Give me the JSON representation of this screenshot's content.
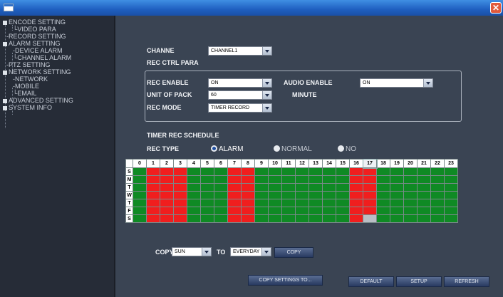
{
  "window": {
    "close_glyph": "✕"
  },
  "sidebar": {
    "items": [
      {
        "label": "ENCODE SETTING"
      },
      {
        "label": "VIDEO PARA"
      },
      {
        "label": "RECORD SETTING"
      },
      {
        "label": "ALARM SETTING"
      },
      {
        "label": "DEVICE ALARM"
      },
      {
        "label": "CHANNEL ALARM"
      },
      {
        "label": "PTZ SETTING"
      },
      {
        "label": "NETWORK SETTING"
      },
      {
        "label": "NETWORK"
      },
      {
        "label": "MOBILE"
      },
      {
        "label": "EMAIL"
      },
      {
        "label": "ADVANCED SETTING"
      },
      {
        "label": "SYSTEM INFO"
      }
    ]
  },
  "form": {
    "channel_label": "CHANNE",
    "channel_value": "CHANNEL1",
    "rec_ctrl_title": "REC CTRL PARA",
    "rec_enable_label": "REC ENABLE",
    "rec_enable_value": "ON",
    "audio_enable_label": "AUDIO ENABLE",
    "audio_enable_value": "ON",
    "unit_pack_label": "UNIT OF PACK",
    "unit_pack_value": "60",
    "minute_label": "MINUTE",
    "rec_mode_label": "REC MODE",
    "rec_mode_value": "TIMER RECORD"
  },
  "schedule": {
    "title": "TIMER REC SCHEDULE",
    "rec_type_label": "REC TYPE",
    "rec_types": [
      {
        "label": "ALARM",
        "checked": true
      },
      {
        "label": "NORMAL",
        "checked": false
      },
      {
        "label": "NO",
        "checked": false
      }
    ],
    "hours": [
      "0",
      "1",
      "2",
      "3",
      "4",
      "5",
      "6",
      "7",
      "8",
      "9",
      "10",
      "11",
      "12",
      "13",
      "14",
      "15",
      "16",
      "17",
      "18",
      "19",
      "20",
      "21",
      "22",
      "23"
    ],
    "days": [
      "S",
      "M",
      "T",
      "W",
      "T",
      "F",
      "S"
    ],
    "red_hours": [
      1,
      2,
      3,
      7,
      8,
      16,
      17
    ],
    "selected_hour": 17,
    "selected_cell": {
      "day_index": 6,
      "hour": 17
    },
    "colors": {
      "alarm": "#f01e1e",
      "normal": "#0f8a24",
      "selected": "#b9bec5"
    }
  },
  "copy": {
    "label": "COPY",
    "from_value": "SUN",
    "to_label": "TO",
    "to_value": "EVERYDAY",
    "button": "COPY"
  },
  "buttons": {
    "copy_settings": "COPY SETTINGS TO...",
    "default": "DEFAULT",
    "setup": "SETUP",
    "refresh": "REFRESH"
  }
}
